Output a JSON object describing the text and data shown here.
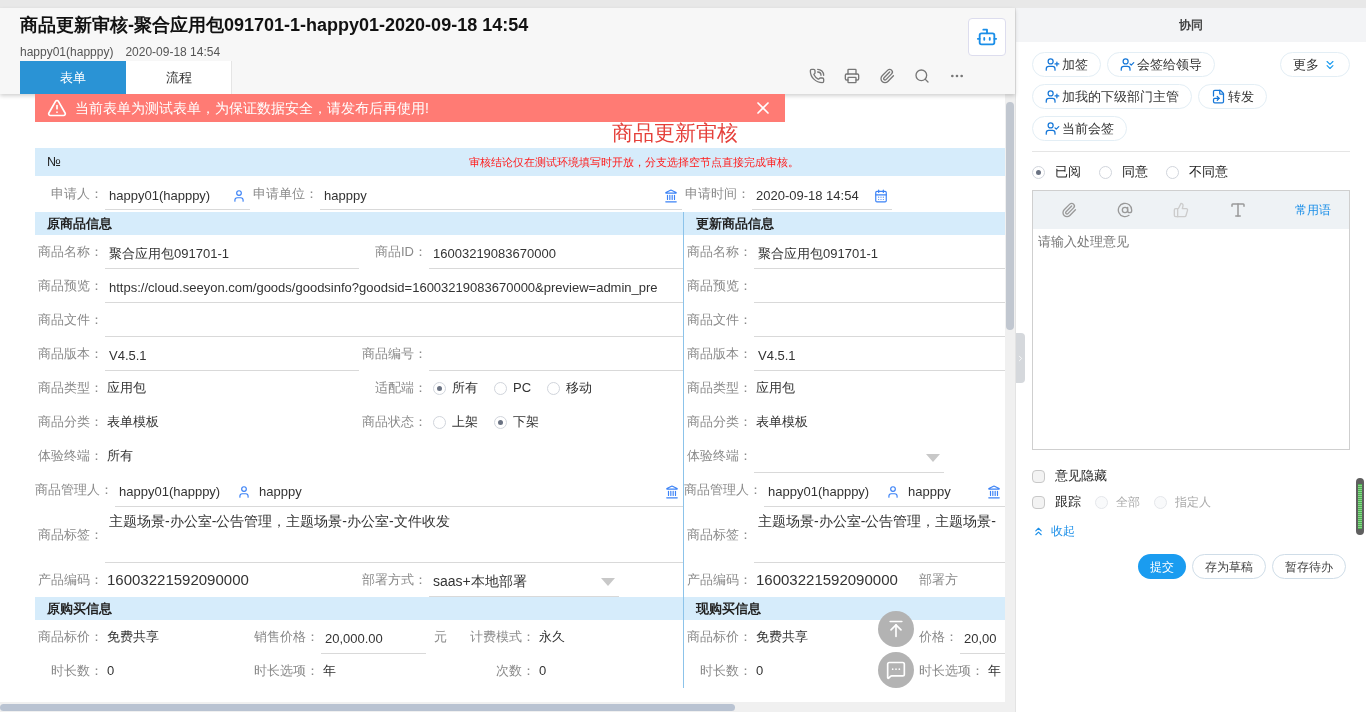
{
  "header": {
    "title": "商品更新审核-聚合应用包091701-1-happy01-2020-09-18 14:54",
    "author": "happy01(happpy)",
    "time": "2020-09-18 14:54",
    "tabs": [
      {
        "label": "表单",
        "selected": true
      },
      {
        "label": "流程",
        "selected": false
      }
    ]
  },
  "banner": {
    "message": "当前表单为测试表单，为保证数据安全，请发布后再使用!"
  },
  "form": {
    "title": "商品更新审核",
    "number_label": "№",
    "note": "审核结论仅在测试环境填写时开放，分支选择空节点直接完成审核。",
    "applicant": [
      {
        "label": "申请人：",
        "value": "happy01(happpy)",
        "kind": "user"
      },
      {
        "label": "申请单位：",
        "value": "happpy",
        "kind": "org"
      },
      {
        "label": "申请时间：",
        "value": "2020-09-18 14:54",
        "kind": "date"
      }
    ],
    "left": [
      {
        "kind": "heading",
        "text": "原商品信息"
      },
      {
        "kind": "row",
        "fields": [
          {
            "label": "商品名称：",
            "value": "聚合应用包091701-1",
            "kind": "text"
          },
          {
            "label": "商品ID：",
            "value": "16003219083670000",
            "kind": "text"
          }
        ]
      },
      {
        "kind": "row",
        "fields": [
          {
            "label": "商品预览：",
            "value": "https://cloud.seeyon.com/goods/goodsinfo?goodsid=16003219083670000&preview=admin_pre",
            "kind": "text"
          }
        ]
      },
      {
        "kind": "row",
        "fields": [
          {
            "label": "商品文件：",
            "kind": "text"
          }
        ]
      },
      {
        "kind": "row",
        "fields": [
          {
            "label": "商品版本：",
            "value": "V4.5.1",
            "kind": "text"
          },
          {
            "label": "商品编号：",
            "kind": "text"
          }
        ]
      },
      {
        "kind": "row",
        "fields": [
          {
            "label": "商品类型：",
            "value": "应用包",
            "kind": "plain"
          },
          {
            "label": "适配端：",
            "kind": "radio",
            "options": [
              {
                "label": "所有",
                "selected": true
              },
              {
                "label": "PC",
                "selected": false
              },
              {
                "label": "移动",
                "selected": false
              }
            ]
          }
        ]
      },
      {
        "kind": "row",
        "fields": [
          {
            "label": "商品分类：",
            "value": "表单模板",
            "kind": "plain"
          },
          {
            "label": "商品状态：",
            "kind": "radio",
            "options": [
              {
                "label": "上架",
                "selected": false
              },
              {
                "label": "下架",
                "selected": true
              }
            ]
          }
        ]
      },
      {
        "kind": "row",
        "fields": [
          {
            "label": "体验终端：",
            "value": "所有",
            "kind": "plain"
          }
        ]
      },
      {
        "kind": "row",
        "fields": [
          {
            "label": "商品管理人：",
            "value": "happy01(happpy)",
            "org": "happpy",
            "kind": "manager"
          }
        ]
      },
      {
        "kind": "row",
        "fields": [
          {
            "label": "商品标签：",
            "value": "主题场景-办公室-公告管理，主题场景-办公室-文件收发",
            "kind": "tags"
          }
        ]
      },
      {
        "kind": "row",
        "fields": [
          {
            "label": "产品编码：",
            "value": "16003221592090000",
            "kind": "code"
          },
          {
            "label": "部署方式：",
            "value": "saas+本地部署",
            "kind": "select"
          }
        ]
      },
      {
        "kind": "heading",
        "text": "原购买信息"
      },
      {
        "kind": "row",
        "fields": [
          {
            "label": "商品标价：",
            "value": "免费共享",
            "kind": "plain"
          },
          {
            "label": "销售价格：",
            "value": "20,000.00",
            "unit": "元",
            "kind": "price"
          },
          {
            "label": "计费模式：",
            "value": "永久",
            "kind": "plain"
          }
        ]
      },
      {
        "kind": "row",
        "fields": [
          {
            "label": "时长数：",
            "value": "0",
            "kind": "plain"
          },
          {
            "label": "时长选项：",
            "value": "年",
            "kind": "plain"
          },
          {
            "label": "次数：",
            "value": "0",
            "kind": "plain"
          }
        ]
      }
    ],
    "right": [
      {
        "kind": "heading",
        "text": "更新商品信息"
      },
      {
        "kind": "row",
        "fields": [
          {
            "label": "商品名称：",
            "value": "聚合应用包091701-1",
            "kind": "text"
          }
        ]
      },
      {
        "kind": "row",
        "fields": [
          {
            "label": "商品预览：",
            "kind": "text"
          }
        ]
      },
      {
        "kind": "row",
        "fields": [
          {
            "label": "商品文件：",
            "kind": "text"
          }
        ]
      },
      {
        "kind": "row",
        "fields": [
          {
            "label": "商品版本：",
            "value": "V4.5.1",
            "kind": "text"
          }
        ]
      },
      {
        "kind": "row",
        "fields": [
          {
            "label": "商品类型：",
            "value": "应用包",
            "kind": "plain"
          }
        ]
      },
      {
        "kind": "row",
        "fields": [
          {
            "label": "商品分类：",
            "value": "表单模板",
            "kind": "plain"
          }
        ]
      },
      {
        "kind": "row",
        "fields": [
          {
            "label": "体验终端：",
            "kind": "select"
          }
        ]
      },
      {
        "kind": "row",
        "fields": [
          {
            "label": "商品管理人：",
            "value": "happy01(happpy)",
            "org": "happpy",
            "kind": "manager"
          }
        ]
      },
      {
        "kind": "row",
        "fields": [
          {
            "label": "商品标签：",
            "value": "主题场景-办公室-公告管理，主题场景-",
            "kind": "tags"
          }
        ]
      },
      {
        "kind": "row",
        "fields": [
          {
            "label": "产品编码：",
            "value": "16003221592090000",
            "kind": "code"
          },
          {
            "label": "部署方",
            "kind": "plain"
          }
        ]
      },
      {
        "kind": "heading",
        "text": "现购买信息"
      },
      {
        "kind": "row",
        "fields": [
          {
            "label": "商品标价：",
            "value": "免费共享",
            "kind": "plain"
          },
          {
            "label": "价格：",
            "value": "20,00",
            "kind": "text"
          }
        ]
      },
      {
        "kind": "row",
        "fields": [
          {
            "label": "时长数：",
            "value": "0",
            "kind": "plain"
          },
          {
            "label": "时长选项：",
            "value": "年",
            "kind": "plain"
          }
        ]
      }
    ]
  },
  "panel": {
    "title": "协同",
    "actions": [
      {
        "label": "加签",
        "kind": "add"
      },
      {
        "label": "会签给领导",
        "kind": "sign"
      },
      {
        "label": "加我的下级部门主管",
        "kind": "add"
      },
      {
        "label": "转发",
        "kind": "forward"
      },
      {
        "label": "当前会签",
        "kind": "sign"
      }
    ],
    "more": "更多",
    "attitudes": [
      {
        "label": "已阅",
        "selected": true
      },
      {
        "label": "同意",
        "selected": false
      },
      {
        "label": "不同意",
        "selected": false
      }
    ],
    "editor": {
      "phrases": "常用语",
      "placeholder": "请输入处理意见"
    },
    "options": [
      {
        "label": "意见隐藏",
        "checked": false
      },
      {
        "label": "跟踪",
        "checked": false,
        "choices": [
          {
            "label": "全部",
            "selected": false,
            "disabled": true
          },
          {
            "label": "指定人",
            "selected": false,
            "disabled": true
          }
        ]
      }
    ],
    "collapse": "收起",
    "buttons": [
      {
        "label": "提交",
        "primary": true
      },
      {
        "label": "存为草稿",
        "primary": false
      },
      {
        "label": "暂存待办",
        "primary": false
      }
    ]
  }
}
